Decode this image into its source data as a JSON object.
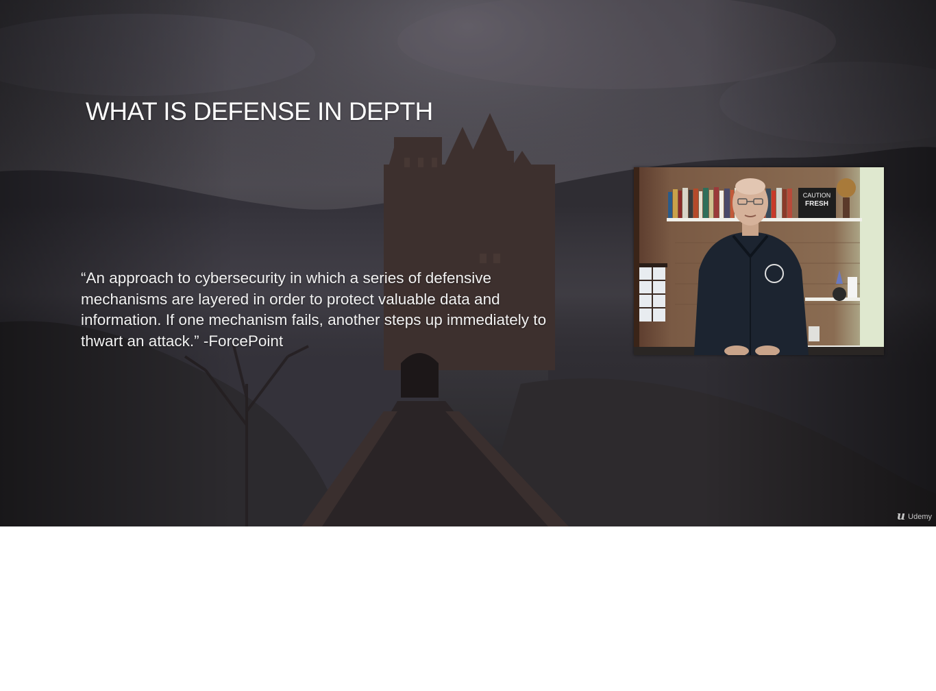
{
  "slide": {
    "title": "WHAT IS DEFENSE IN DEPTH",
    "quote": "“An approach to cybersecurity in which a series of defensive mechanisms are layered in order to protect valuable data and information. If one mechanism fails, another steps up immediately to thwart an attack.” -ForcePoint"
  },
  "webcam": {
    "sign_line1": "CAUTION",
    "sign_line2": "FRESH"
  },
  "watermark": {
    "mark": "u",
    "text": "Udemy"
  },
  "colors": {
    "sky": "#4a4750",
    "hills": "#2b2a2e",
    "castle": "#3a2e2c",
    "text": "#ffffff"
  }
}
